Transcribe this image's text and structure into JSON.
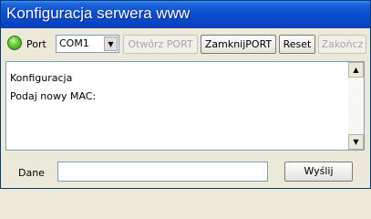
{
  "window": {
    "title": "Konfiguracja serwera www"
  },
  "port_row": {
    "port_label": "Port",
    "port_select_value": "COM1",
    "buttons": {
      "open_port": "Otwórz PORT",
      "close_port": "ZamknijPORT",
      "reset": "Reset",
      "finish": "Zakończ"
    }
  },
  "log": {
    "lines": [
      "Konfiguracja",
      "Podaj nowy MAC:"
    ]
  },
  "send_row": {
    "data_label": "Dane",
    "data_value": "",
    "send_button": "Wyślij"
  },
  "icons": {
    "status_led": "green-led-icon",
    "dropdown": "chevron-down-icon",
    "scroll_up": "arrow-up-icon",
    "scroll_down": "arrow-down-icon"
  },
  "colors": {
    "title_bar": "#0a4fd0",
    "led": "#3fae1e",
    "window_bg": "#ece9d8"
  }
}
